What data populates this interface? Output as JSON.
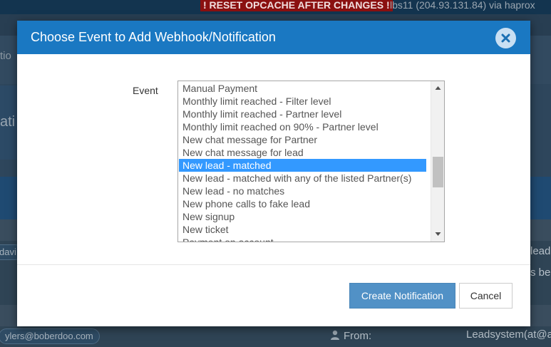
{
  "background": {
    "warning_banner": "! RESET OPCACHE AFTER CHANGES !",
    "host_info": "lbs11 (204.93.131.84) via haprox",
    "menu_fragment": "tio",
    "heading_fragment": "ati",
    "email_pill": "ylers@boberdoo.com",
    "user_pill_fragment": "davi",
    "right_fragment_1": "lead",
    "right_fragment_2": "s be",
    "from_label": "From:",
    "from_value": "Leadsystem(at@a"
  },
  "modal": {
    "title": "Choose Event to Add Webhook/Notification",
    "close_icon": "close-icon",
    "event_label": "Event",
    "event_options": [
      "Manual Payment",
      "Monthly limit reached - Filter level",
      "Monthly limit reached - Partner level",
      "Monthly limit reached on 90% - Partner level",
      "New chat message for Partner",
      "New chat message for lead",
      "New lead - matched",
      "New lead - matched with any of the listed Partner(s)",
      "New lead - no matches",
      "New phone calls to fake lead",
      "New signup",
      "New ticket",
      "Payment on account"
    ],
    "selected_event": "New lead - matched",
    "create_button": "Create Notification",
    "cancel_button": "Cancel"
  },
  "colors": {
    "header_blue": "#1a78c2",
    "selection_blue": "#3399ff",
    "primary_button": "#5191c6",
    "warning_red": "#8a1010"
  }
}
